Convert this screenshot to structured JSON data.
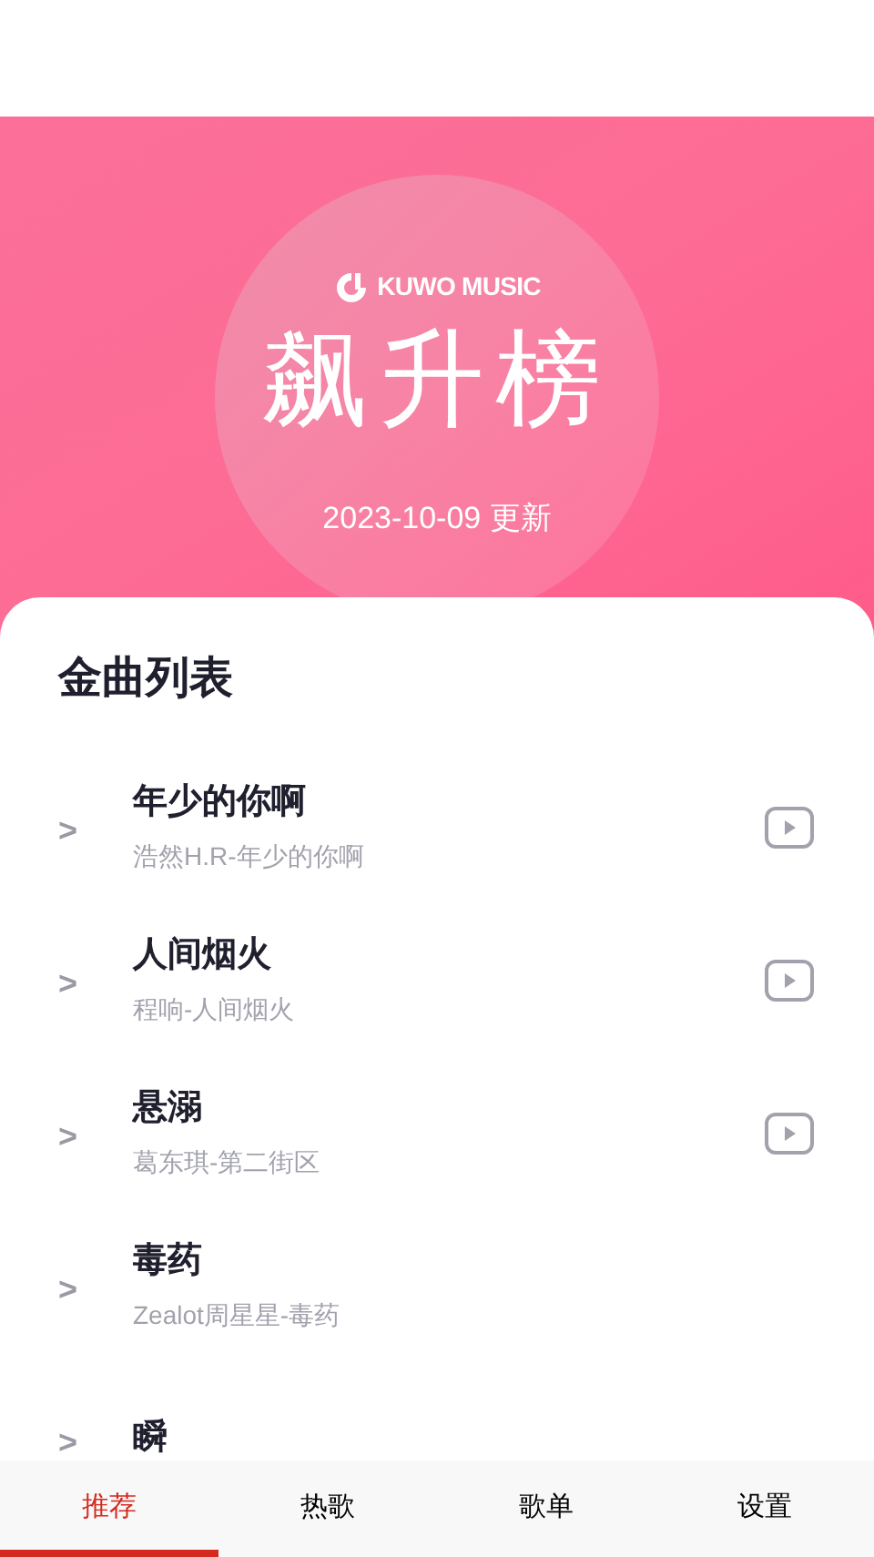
{
  "header": {
    "logo": "KUWO MUSIC",
    "title": "飙升榜",
    "date": "2023-10-09 更新"
  },
  "list": {
    "title": "金曲列表",
    "songs": [
      {
        "arrow": ">",
        "title": "年少的你啊",
        "subtitle": "浩然H.R-年少的你啊",
        "has_video": true
      },
      {
        "arrow": ">",
        "title": "人间烟火",
        "subtitle": "程响-人间烟火",
        "has_video": true
      },
      {
        "arrow": ">",
        "title": "悬溺",
        "subtitle": "葛东琪-第二街区",
        "has_video": true
      },
      {
        "arrow": ">",
        "title": "毒药",
        "subtitle": "Zealot周星星-毒药",
        "has_video": false
      },
      {
        "arrow": ">",
        "title": "瞬",
        "has_video": false
      }
    ]
  },
  "tabs": [
    {
      "label": "推荐",
      "selected": true
    },
    {
      "label": "热歌",
      "selected": false
    },
    {
      "label": "歌单",
      "selected": false
    },
    {
      "label": "设置",
      "selected": false
    }
  ]
}
